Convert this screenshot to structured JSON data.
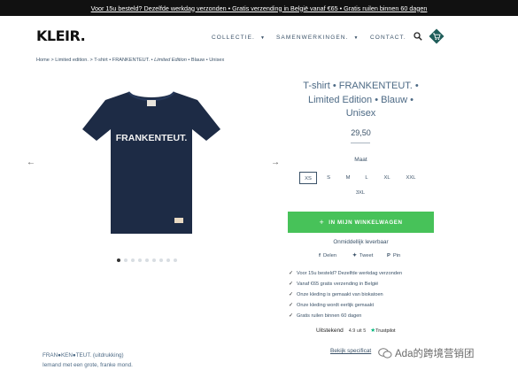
{
  "announcement": "Voor 15u besteld? Dezelfde werkdag verzonden • Gratis verzending in België vanaf €65 • Gratis ruilen binnen 60 dagen",
  "header": {
    "logo": "KLEIR.",
    "nav": [
      "COLLECTIE.",
      "SAMENWERKINGEN.",
      "CONTACT."
    ]
  },
  "breadcrumb": {
    "home": "Home",
    "sep": " > ",
    "collection": "Limited edition.",
    "product_a": "T-shirt • FRANKENTEUT. •",
    "product_b": "Limited Edition",
    "product_c": "• Blauw • Unisex"
  },
  "product": {
    "title_lines": [
      "T-shirt • FRANKENTEUT. •",
      "Limited Edition • Blauw •",
      "Unisex"
    ],
    "print_text": "FRANKENTEUT.",
    "price": "29,50",
    "size_label": "Maat",
    "sizes": [
      "XS",
      "S",
      "M",
      "L",
      "XL",
      "XXL",
      "3XL"
    ],
    "selected_size": "XS",
    "add_to_cart": "IN MIJN WINKELWAGEN",
    "availability": "Onmiddellijk leverbaar",
    "gallery_count": 9,
    "gallery_active": 1
  },
  "share": {
    "facebook": "Delen",
    "twitter": "Tweet",
    "pinterest": "Pin"
  },
  "usps": [
    "Voor 15u besteld? Dezelfde werkdag verzonden",
    "Vanaf €65 gratis verzending in België",
    "Onze kleding is gemaakt van biokatoen",
    "Onze kleding wordt eerlijk gemaakt",
    "Gratis ruilen binnen 60 dagen"
  ],
  "trustpilot": {
    "label": "Uitstekend",
    "score": "4.9 uit 5",
    "brand": "Trustpilot"
  },
  "specs_link": "Bekijk specificat",
  "description": {
    "term": "FRAN●KEN●TEUT. (uitdrukking)",
    "definition": "Iemand met een grote, franke mond."
  },
  "watermark": "Ada的跨境营销团",
  "colors": {
    "topbar": "#111111",
    "accent_green": "#47c259",
    "text_blue": "#3b5268",
    "shirt_navy": "#1d2b45",
    "cart_teal": "#1f5d5a"
  }
}
